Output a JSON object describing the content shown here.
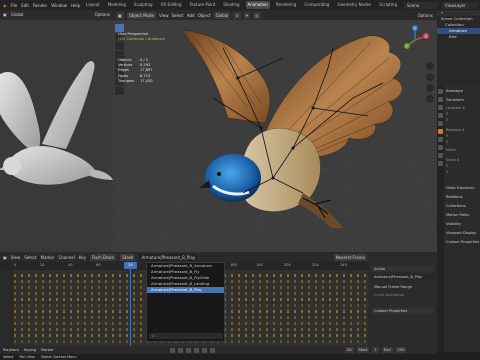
{
  "topbar": {
    "menus": [
      "File",
      "Edit",
      "Render",
      "Window",
      "Help"
    ],
    "workspaces": [
      "Layout",
      "Modeling",
      "Sculpting",
      "UV Editing",
      "Texture Paint",
      "Shading",
      "Animation",
      "Rendering",
      "Compositing",
      "Geometry Nodes",
      "Scripting"
    ],
    "active_workspace": "Animation",
    "scene": "Scene",
    "view_layer": "ViewLayer"
  },
  "left_view": {
    "header": [
      "Global"
    ],
    "options": "Options"
  },
  "main_view": {
    "header": {
      "mode": "Object Mode",
      "menus": [
        "View",
        "Select",
        "Add",
        "Object"
      ],
      "transform": "Global",
      "options": "Options"
    },
    "overlay": {
      "view_name": "User Perspective",
      "collection": "(20) Collection | Armature"
    },
    "stats": [
      {
        "k": "Objects",
        "v": "0 / 2"
      },
      {
        "k": "Vertices",
        "v": "9,293"
      },
      {
        "k": "Edges",
        "v": "17,897"
      },
      {
        "k": "Faces",
        "v": "8,713"
      },
      {
        "k": "Triangles",
        "v": "17,430"
      }
    ],
    "gizmo": {
      "x": "X",
      "y": "Y",
      "z": "Z"
    }
  },
  "outliner": {
    "rows": [
      "Scene Collection",
      "Collection",
      "Armature",
      "Bird"
    ]
  },
  "properties": {
    "object_name": "Armature",
    "sections": [
      "Transform",
      "Delta Transform",
      "Relations",
      "Collections",
      "Motion Paths",
      "Visibility",
      "Viewport Display",
      "Custom Properties"
    ],
    "fields": [
      "Location X",
      "Y",
      "Z",
      "Rotation X",
      "Y",
      "Z",
      "Mode",
      "Scale X",
      "Y",
      "Z"
    ]
  },
  "timeline": {
    "menus": [
      "View",
      "Select",
      "Marker",
      "Channel",
      "Key"
    ],
    "mode": "Dope Sheet",
    "action": "Action",
    "push_down": "Push Down",
    "stash": "Stash",
    "ticks": [
      "0",
      "20",
      "40",
      "60",
      "80",
      "100",
      "120",
      "140",
      "160",
      "180",
      "200",
      "220",
      "240"
    ],
    "current_frame": "20"
  },
  "action_menu": {
    "items": [
      "Armature|Pheasant_B_Armature",
      "Armature|Pheasant_B_Fly",
      "Armature|Pheasant_B_FlyGlide",
      "Armature|Pheasant_B_Landing",
      "Armature|Pheasant_B_Play"
    ],
    "selected": 4,
    "search_placeholder": "⌕"
  },
  "side_panel": {
    "tab": "Action",
    "action_field": "Armature|Pheasant_B_Play",
    "manual_range": "Manual Frame Range",
    "cyclic": "Cyclic Animation",
    "custom_props": "Custom Properties",
    "nearest_frame": "Nearest Frame"
  },
  "footer": {
    "playback": "Playback",
    "keying": "Keying",
    "marker": "Marker",
    "frame": "20",
    "start": "Start",
    "start_val": "1",
    "end": "End",
    "end_val": "250"
  },
  "statusbar": {
    "select": "Select",
    "pan": "Pan View",
    "context": "Object Context Menu"
  }
}
